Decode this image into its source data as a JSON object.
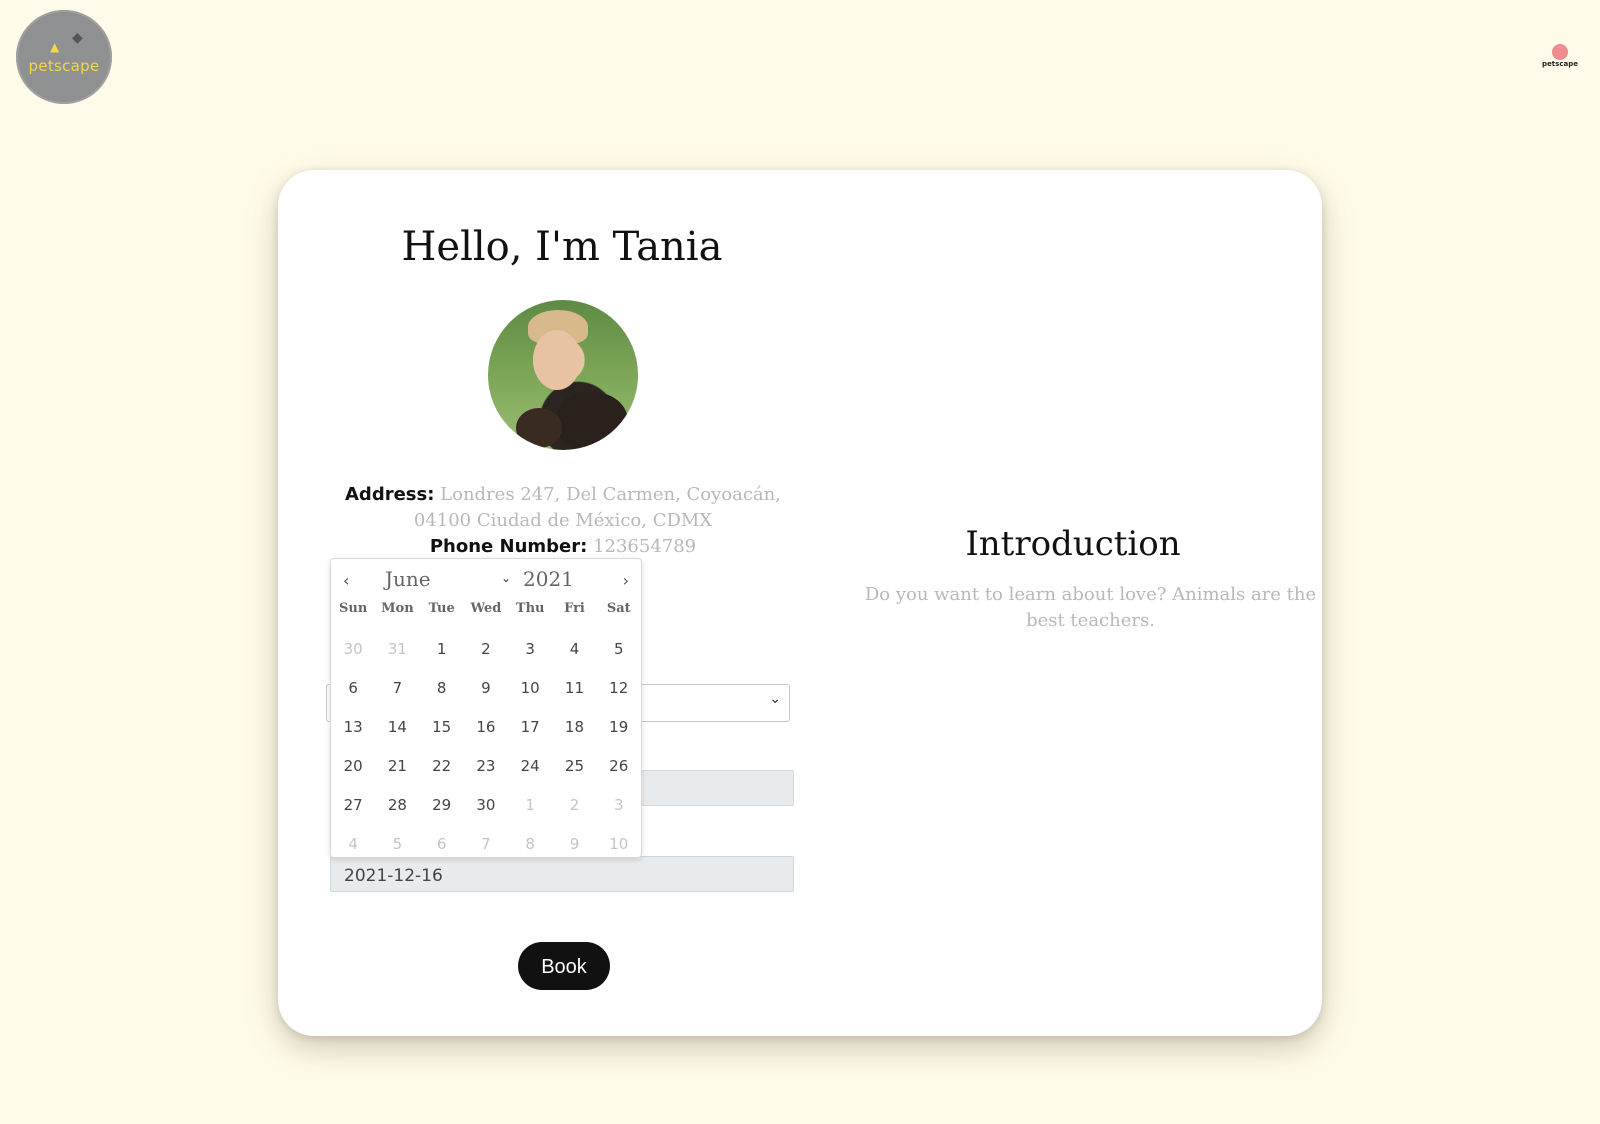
{
  "brand": {
    "logo_text": "petscape",
    "mini_logo_text": "petscape"
  },
  "profile": {
    "title": "Hello, I'm Tania",
    "address_label": "Address:",
    "address_value": "Londres 247, Del Carmen, Coyoacán, 04100 Ciudad de México, CDMX",
    "phone_label": "Phone Number:",
    "phone_value": "123654789"
  },
  "form": {
    "date_value": "2021-12-16",
    "book_label": "Book"
  },
  "intro": {
    "title": "Introduction",
    "text": "Do you want to learn about love? Animals are the best teachers."
  },
  "datepicker": {
    "month": "June",
    "year": "2021",
    "weekdays": [
      "Sun",
      "Mon",
      "Tue",
      "Wed",
      "Thu",
      "Fri",
      "Sat"
    ],
    "weeks": [
      [
        "30",
        "31",
        "1",
        "2",
        "3",
        "4",
        "5"
      ],
      [
        "6",
        "7",
        "8",
        "9",
        "10",
        "11",
        "12"
      ],
      [
        "13",
        "14",
        "15",
        "16",
        "17",
        "18",
        "19"
      ],
      [
        "20",
        "21",
        "22",
        "23",
        "24",
        "25",
        "26"
      ],
      [
        "27",
        "28",
        "29",
        "30",
        "1",
        "2",
        "3"
      ],
      [
        "4",
        "5",
        "6",
        "7",
        "8",
        "9",
        "10"
      ]
    ],
    "outside_month": [
      [
        true,
        true,
        false,
        false,
        false,
        false,
        false
      ],
      [
        false,
        false,
        false,
        false,
        false,
        false,
        false
      ],
      [
        false,
        false,
        false,
        false,
        false,
        false,
        false
      ],
      [
        false,
        false,
        false,
        false,
        false,
        false,
        false
      ],
      [
        false,
        false,
        false,
        false,
        true,
        true,
        true
      ],
      [
        true,
        true,
        true,
        true,
        true,
        true,
        true
      ]
    ]
  },
  "colors": {
    "page_bg": "#fffbea",
    "card_bg": "#ffffff",
    "button_bg": "#111111",
    "muted_text": "#b8b8b8"
  }
}
